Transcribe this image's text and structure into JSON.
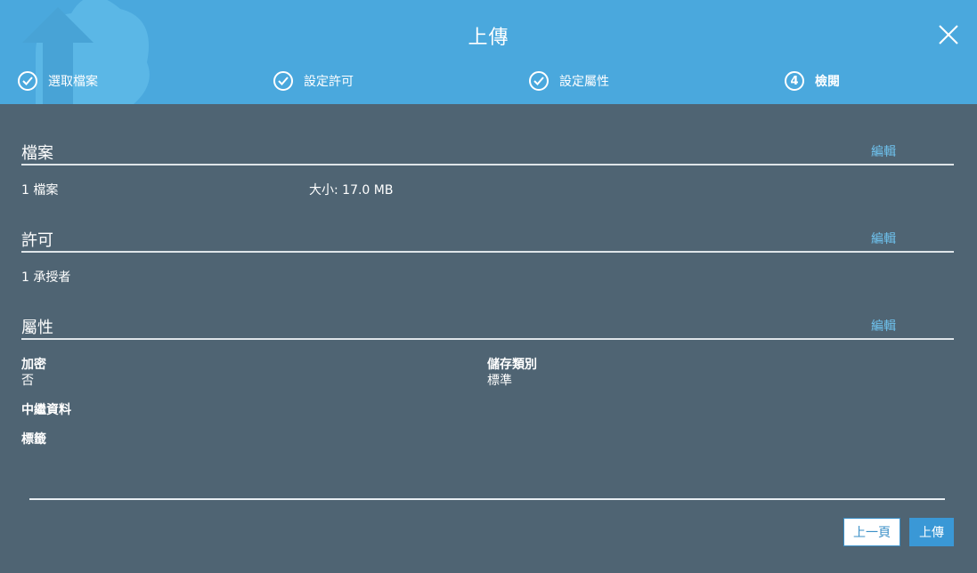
{
  "dialog": {
    "title": "上傳"
  },
  "steps": [
    {
      "label": "選取檔案",
      "state": "done"
    },
    {
      "label": "設定許可",
      "state": "done"
    },
    {
      "label": "設定屬性",
      "state": "done"
    },
    {
      "label": "檢閱",
      "state": "active",
      "number": "4"
    }
  ],
  "files": {
    "title": "檔案",
    "edit": "編輯",
    "count": "1 檔案",
    "size": "大小: 17.0 MB"
  },
  "permissions": {
    "title": "許可",
    "edit": "編輯",
    "grantees": "1 承授者"
  },
  "properties": {
    "title": "屬性",
    "edit": "編輯",
    "encryption_label": "加密",
    "encryption_value": "否",
    "storage_class_label": "儲存類別",
    "storage_class_value": "標準",
    "metadata_label": "中繼資料",
    "tags_label": "標籤"
  },
  "footer": {
    "prev_label": "上一頁",
    "upload_label": "上傳"
  },
  "colors": {
    "header_bg": "#4aa8dd",
    "body_bg": "#4f6473",
    "link": "#6fc3ef",
    "primary_button": "#3a98d6"
  }
}
